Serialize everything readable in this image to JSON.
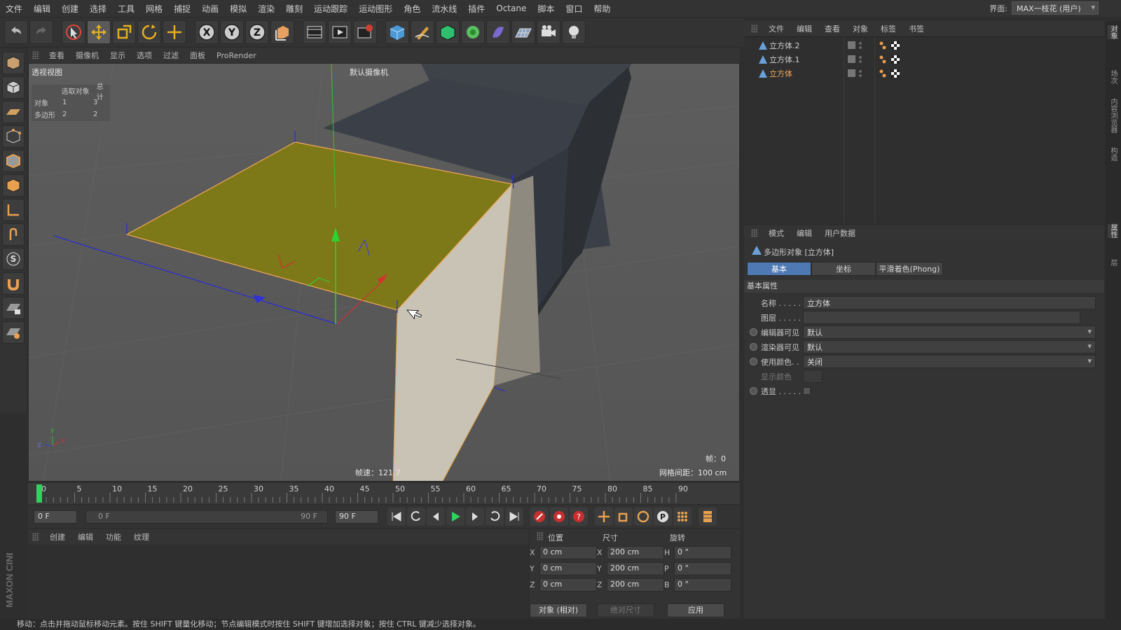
{
  "menu": [
    "文件",
    "编辑",
    "创建",
    "选择",
    "工具",
    "网格",
    "捕捉",
    "动画",
    "模拟",
    "渲染",
    "雕刻",
    "运动跟踪",
    "运动图形",
    "角色",
    "流水线",
    "插件",
    "Octane",
    "脚本",
    "窗口",
    "帮助"
  ],
  "layout": {
    "label": "界面:",
    "value": "MAX一枝花 (用户)"
  },
  "toolbar_icons": [
    "undo-icon",
    "redo-icon",
    "select-live-icon",
    "move-icon",
    "scale-icon",
    "rotate-icon",
    "transform-icon",
    "x-axis-icon",
    "y-axis-icon",
    "z-axis-icon",
    "coord-system-icon",
    "render-view-icon",
    "render-to-picture-viewer-icon",
    "render-settings-icon",
    "cube-icon",
    "pen-icon",
    "subdivision-icon",
    "cloner-icon",
    "deformer-icon",
    "floor-icon",
    "camera-icon",
    "light-icon"
  ],
  "viewport": {
    "menu": [
      "查看",
      "摄像机",
      "显示",
      "选项",
      "过滤",
      "面板",
      "ProRender"
    ],
    "name": "透视视图",
    "camera": "默认摄像机",
    "stats": {
      "header_sel": "选取对象",
      "header_total": "总计",
      "rows": [
        {
          "label": "对象",
          "sel": "1",
          "total": "3"
        },
        {
          "label": "多边形",
          "sel": "2",
          "total": "2"
        }
      ]
    },
    "fps": "帧速：121.7",
    "grid": "网格间距：100 cm",
    "frame": "帧：0"
  },
  "timeline": {
    "ticks": [
      "0",
      "5",
      "10",
      "15",
      "20",
      "25",
      "30",
      "35",
      "40",
      "45",
      "50",
      "55",
      "60",
      "65",
      "70",
      "75",
      "80",
      "85",
      "90"
    ],
    "current": "0 F"
  },
  "transport": {
    "start": "0 F",
    "range_start": "0 F",
    "range_end": "90 F",
    "end": "90 F"
  },
  "material": {
    "menu": [
      "创建",
      "编辑",
      "功能",
      "纹理"
    ]
  },
  "coords": {
    "headers": {
      "pos": "位置",
      "size": "尺寸",
      "rot": "旋转"
    },
    "pos": [
      {
        "axis": "X",
        "value": "0 cm"
      },
      {
        "axis": "Y",
        "value": "0 cm"
      },
      {
        "axis": "Z",
        "value": "0 cm"
      }
    ],
    "size": [
      {
        "axis": "X",
        "value": "200 cm"
      },
      {
        "axis": "Y",
        "value": "200 cm"
      },
      {
        "axis": "Z",
        "value": "200 cm"
      }
    ],
    "rot": [
      {
        "axis": "H",
        "value": "0 °"
      },
      {
        "axis": "P",
        "value": "0 °"
      },
      {
        "axis": "B",
        "value": "0 °"
      }
    ],
    "mode": "对象 (相对)",
    "size_mode": "绝对尺寸",
    "apply": "应用"
  },
  "object_manager": {
    "menu": [
      "文件",
      "编辑",
      "查看",
      "对象",
      "标签",
      "书签"
    ],
    "objects": [
      {
        "name": "立方体.2",
        "selected": false
      },
      {
        "name": "立方体.1",
        "selected": false
      },
      {
        "name": "立方体",
        "selected": true
      }
    ]
  },
  "attributes": {
    "menu": [
      "模式",
      "编辑",
      "用户数据"
    ],
    "title": "多边形对象 [立方体]",
    "tabs": [
      {
        "label": "基本",
        "active": true
      },
      {
        "label": "坐标",
        "active": false
      },
      {
        "label": "平滑着色(Phong)",
        "active": false
      }
    ],
    "group": "基本属性",
    "props": [
      {
        "label": "名称 . . . . .",
        "value": "立方体",
        "type": "text",
        "radio": false,
        "dim": false
      },
      {
        "label": "图层 . . . . .",
        "value": "",
        "type": "text",
        "radio": false,
        "dim": false
      },
      {
        "label": "编辑器可见",
        "value": "默认",
        "type": "dd",
        "radio": true,
        "dim": false
      },
      {
        "label": "渲染器可见",
        "value": "默认",
        "type": "dd",
        "radio": true,
        "dim": false
      },
      {
        "label": "使用颜色. .",
        "value": "关闭",
        "type": "dd",
        "radio": true,
        "dim": false
      },
      {
        "label": "显示颜色",
        "value": "",
        "type": "swatch",
        "radio": false,
        "dim": true
      },
      {
        "label": "透显 . . . . .",
        "value": "",
        "type": "check",
        "radio": true,
        "dim": false
      }
    ]
  },
  "right_strip": [
    "对象",
    "场次",
    "内容浏览器",
    "构造",
    "属性",
    "层"
  ],
  "status": "移动：点击并拖动鼠标移动元素。按住 SHIFT 键量化移动；节点编辑模式时按住 SHIFT 键增加选择对象；按住 CTRL 键减少选择对象。",
  "brand": "MAXON CINEMA 4D",
  "colors": {
    "accent_blue": "#4e79b3",
    "selection_orange": "#f0a85a",
    "polygon_yellow": "#7d7818"
  }
}
